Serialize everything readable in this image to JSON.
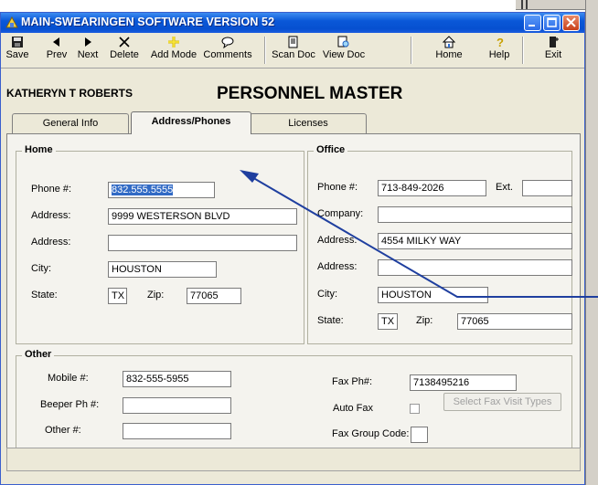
{
  "window": {
    "title": "MAIN-SWEARINGEN SOFTWARE VERSION 52"
  },
  "toolbar": {
    "save": "Save",
    "prev": "Prev",
    "next": "Next",
    "delete": "Delete",
    "add_mode": "Add Mode",
    "comments": "Comments",
    "scan_doc": "Scan Doc",
    "view_doc": "View Doc",
    "home": "Home",
    "help": "Help",
    "exit": "Exit"
  },
  "header": {
    "user_name": "KATHERYN T ROBERTS",
    "form_title": "PERSONNEL MASTER"
  },
  "tabs": [
    {
      "label": "General Info",
      "active": false
    },
    {
      "label": "Address/Phones",
      "active": true
    },
    {
      "label": "Licenses",
      "active": false
    }
  ],
  "home": {
    "title": "Home",
    "phone_label": "Phone #:",
    "phone": "832.555.5555",
    "address1_label": "Address:",
    "address1": "9999 WESTERSON BLVD",
    "address2_label": "Address:",
    "address2": "",
    "city_label": "City:",
    "city": "HOUSTON",
    "state_label": "State:",
    "state": "TX",
    "zip_label": "Zip:",
    "zip": "77065"
  },
  "office": {
    "title": "Office",
    "phone_label": "Phone #:",
    "phone": "713-849-2026",
    "ext_label": "Ext.",
    "ext": "",
    "company_label": "Company:",
    "company": "",
    "address1_label": "Address:",
    "address1": "4554 MILKY WAY",
    "address2_label": "Address:",
    "address2": "",
    "city_label": "City:",
    "city": "HOUSTON",
    "state_label": "State:",
    "state": "TX",
    "zip_label": "Zip:",
    "zip": "77065"
  },
  "other": {
    "title": "Other",
    "mobile_label": "Mobile #:",
    "mobile": "832-555-5955",
    "beeper_label": "Beeper Ph #:",
    "beeper": "",
    "other_label": "Other #:",
    "other_phone": "",
    "fax_label": "Fax Ph#:",
    "fax": "7138495216",
    "auto_fax_label": "Auto Fax",
    "fax_button": "Select Fax Visit Types",
    "fax_group_label": "Fax Group Code:",
    "fax_group": ""
  },
  "colors": {
    "title_bar": "#0a58d8",
    "selection": "#316ac5",
    "annotation": "#1f3f9f"
  }
}
